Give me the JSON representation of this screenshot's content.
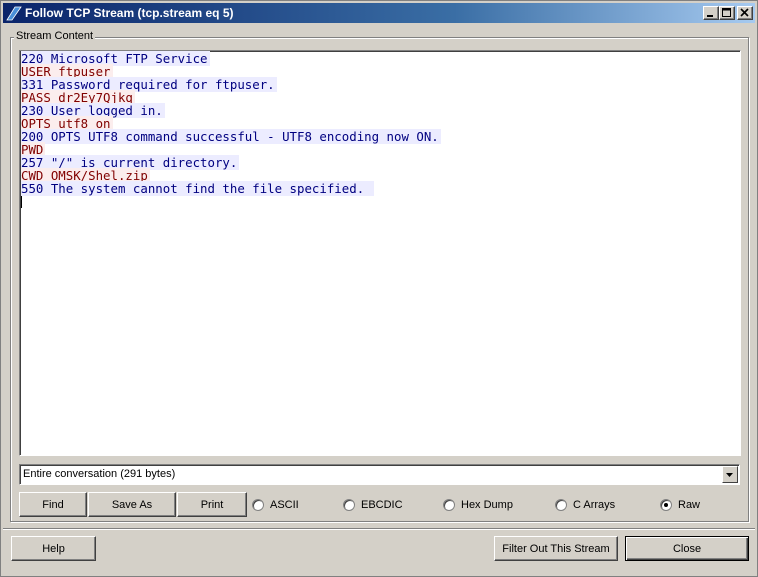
{
  "window": {
    "title": "Follow TCP Stream (tcp.stream eq 5)"
  },
  "titlebar_buttons": [
    "minimize-icon",
    "maximize-icon",
    "close-icon"
  ],
  "stream": {
    "group_label": "Stream Content",
    "lines": [
      {
        "dir": "server",
        "text": "220 Microsoft FTP Service"
      },
      {
        "dir": "client",
        "text": "USER ftpuser"
      },
      {
        "dir": "server",
        "text": "331 Password required for ftpuser."
      },
      {
        "dir": "client",
        "text": "PASS dr2Ey7Qjkq"
      },
      {
        "dir": "server",
        "text": "230 User logged in."
      },
      {
        "dir": "client",
        "text": "OPTS utf8 on"
      },
      {
        "dir": "server",
        "text": "200 OPTS UTF8 command successful - UTF8 encoding now ON."
      },
      {
        "dir": "client",
        "text": "PWD"
      },
      {
        "dir": "server",
        "text": "257 \"/\" is current directory."
      },
      {
        "dir": "client",
        "text": "CWD OMSK/Shel.zip"
      },
      {
        "dir": "server",
        "text": "550 The system cannot find the file specified. "
      }
    ],
    "colors": {
      "server_text": "#000080",
      "server_bg": "#ececff",
      "client_text": "#800000",
      "client_bg": "#fbeded"
    }
  },
  "conversation_select": {
    "selected": "Entire conversation (291 bytes)"
  },
  "buttons": {
    "find": "Find",
    "save_as": "Save As",
    "print": "Print",
    "help": "Help",
    "filter_out": "Filter Out This Stream",
    "close": "Close"
  },
  "format_options": [
    {
      "label": "ASCII",
      "checked": false
    },
    {
      "label": "EBCDIC",
      "checked": false
    },
    {
      "label": "Hex Dump",
      "checked": false
    },
    {
      "label": "C Arrays",
      "checked": false
    },
    {
      "label": "Raw",
      "checked": true
    }
  ]
}
